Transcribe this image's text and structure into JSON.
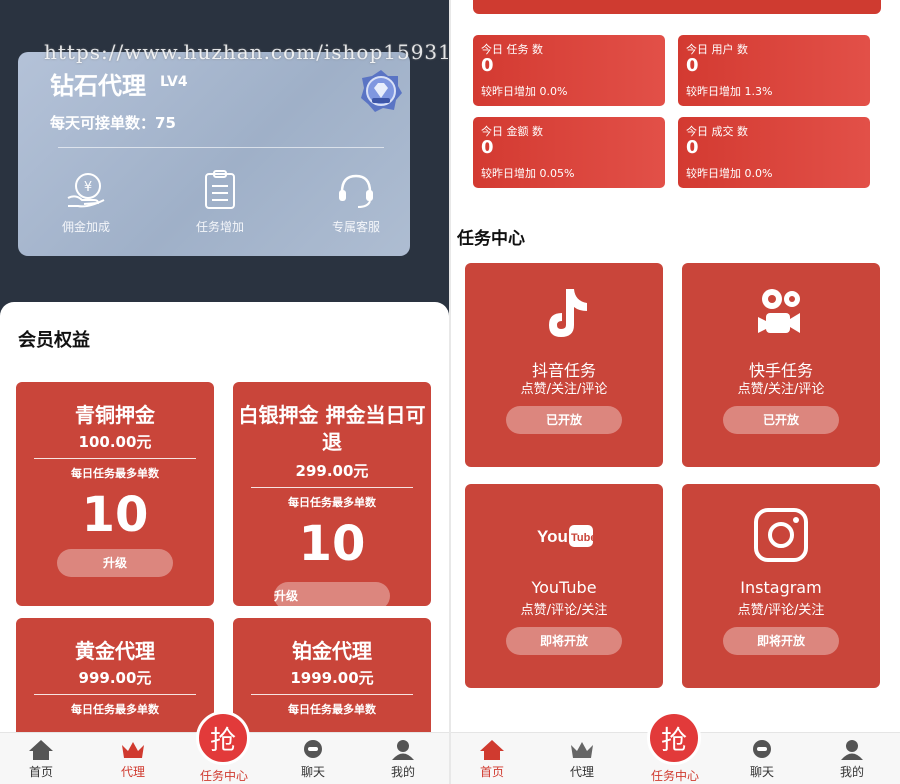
{
  "watermark": "https://www.huzhan.com/ishop15931",
  "left": {
    "vip": {
      "title": "钻石代理",
      "level": "LV4",
      "daily_orders": "每天可接单数：75",
      "perks": [
        "佣金加成",
        "任务增加",
        "专属客服"
      ]
    },
    "section_title": "会员权益",
    "tiers": [
      {
        "name": "青铜押金",
        "price": "100.00元",
        "sub": "每日任务最多单数",
        "count": "10",
        "button": "升级"
      },
      {
        "name": "白银押金 押金当日可退",
        "price": "299.00元",
        "sub": "每日任务最多单数",
        "count": "10",
        "button": "升级"
      },
      {
        "name": "黄金代理",
        "price": "999.00元",
        "sub": "每日任务最多单数"
      },
      {
        "name": "铂金代理",
        "price": "1999.00元",
        "sub": "每日任务最多单数"
      }
    ],
    "tabbar": {
      "home": "首页",
      "agent": "代理",
      "grab": "抢",
      "tasks": "任务中心",
      "chat": "聊天",
      "mine": "我的"
    }
  },
  "right": {
    "stats": [
      {
        "label": "今日 任务 数",
        "value": "0",
        "change": "较昨日增加 0.0%"
      },
      {
        "label": "今日 用户 数",
        "value": "0",
        "change": "较昨日增加 1.3%"
      },
      {
        "label": "今日 金额 数",
        "value": "0",
        "change": "较昨日增加 0.05%"
      },
      {
        "label": "今日 成交 数",
        "value": "0",
        "change": "较昨日增加 0.0%"
      }
    ],
    "section_title": "任务中心",
    "tasks": [
      {
        "name": "抖音任务",
        "sub": "点赞/关注/评论",
        "button": "已开放",
        "icon": "tiktok-icon"
      },
      {
        "name": "快手任务",
        "sub": "点赞/关注/评论",
        "button": "已开放",
        "icon": "kuaishou-icon"
      },
      {
        "name": "YouTube",
        "sub": "点赞/评论/关注",
        "button": "即将开放",
        "icon": "youtube-icon",
        "logo_text": "YouTube"
      },
      {
        "name": "Instagram",
        "sub": "点赞/评论/关注",
        "button": "即将开放",
        "icon": "instagram-icon"
      }
    ],
    "tabbar": {
      "home": "首页",
      "agent": "代理",
      "grab": "抢",
      "tasks": "任务中心",
      "chat": "聊天",
      "mine": "我的"
    }
  },
  "colors": {
    "accent": "#c9453a",
    "dark_header": "#2a3340",
    "active_tab": "#d03a2f"
  }
}
